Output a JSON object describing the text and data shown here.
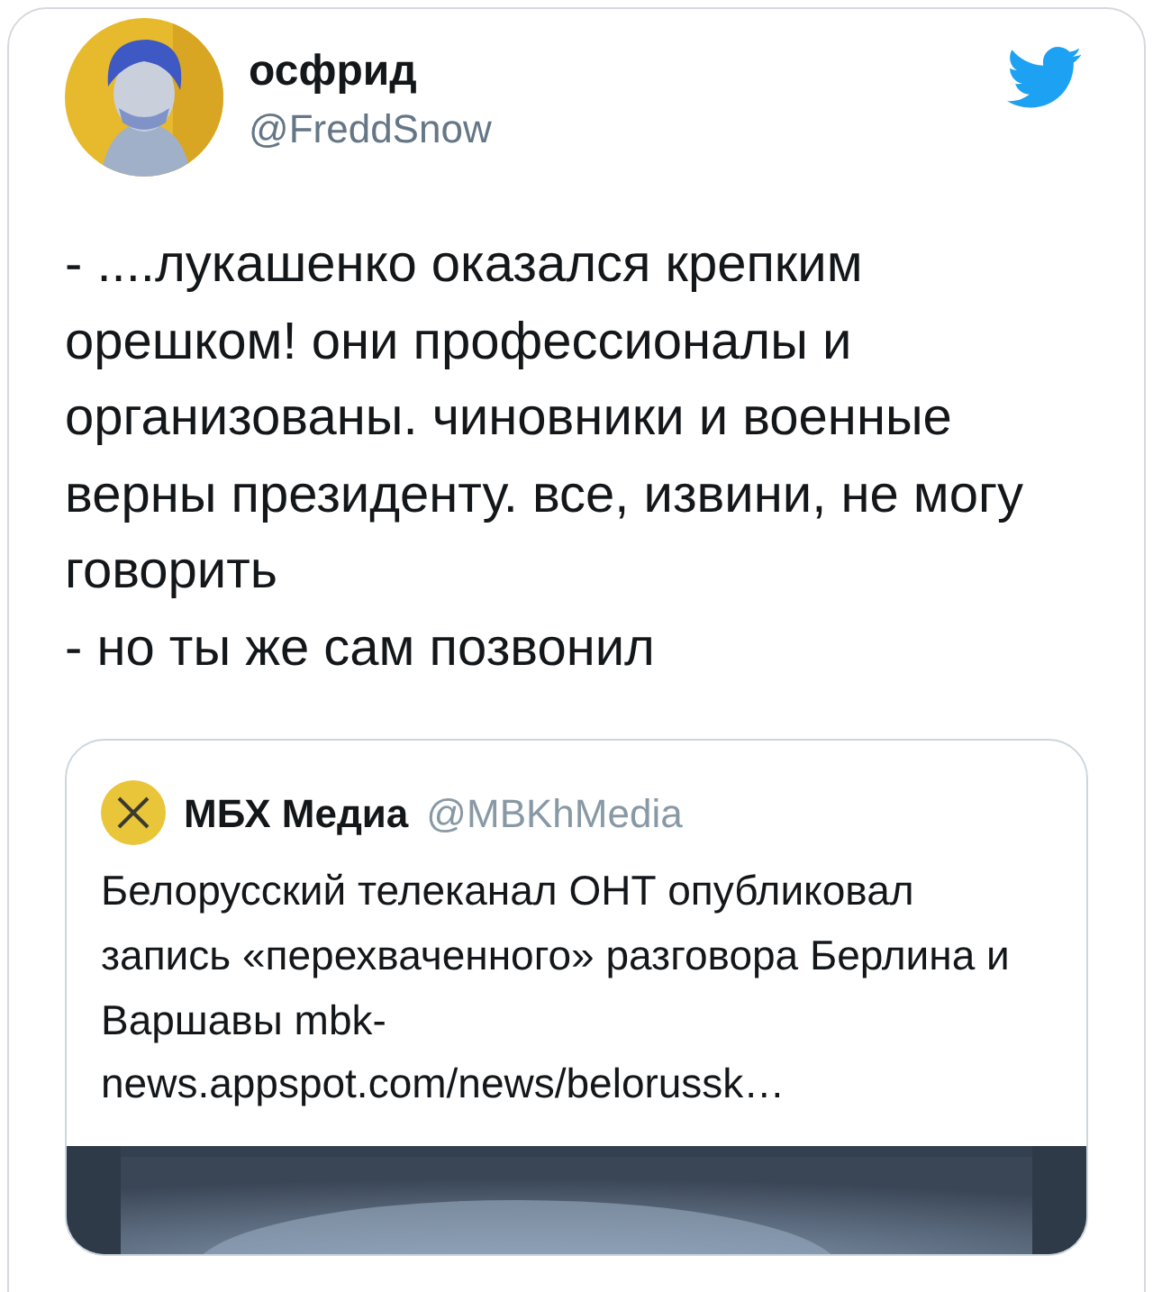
{
  "tweet": {
    "author": {
      "name": "осфрид",
      "handle": "@FreddSnow"
    },
    "paragraphs": [
      "- ....лукашенко оказался крепким орешком! они профессионалы и организованы. чиновники и военные верны президенту. все, извини, не могу говорить",
      "- но ты же сам позвонил"
    ],
    "quoted": {
      "author": {
        "name": "МБХ Медиа",
        "handle": "@MBKhMedia"
      },
      "text": "Белорусский телеканал ОНТ опубликовал запись «перехваченного» разговора Берлина и Варшавы mbk-news.appspot.com/news/belorussk…"
    }
  }
}
